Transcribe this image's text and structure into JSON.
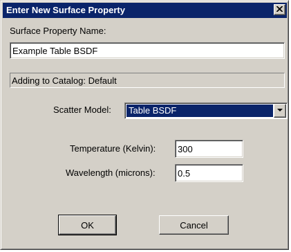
{
  "window": {
    "title": "Enter New Surface Property",
    "close_icon": "close-icon"
  },
  "form": {
    "name_label": "Surface Property Name:",
    "name_value": "Example Table BSDF",
    "catalog_status": "Adding to Catalog: Default",
    "scatter_label": "Scatter Model:",
    "scatter_value": "Table BSDF",
    "temperature_label": "Temperature (Kelvin):",
    "temperature_value": "300",
    "wavelength_label": "Wavelength (microns):",
    "wavelength_value": "0.5"
  },
  "buttons": {
    "ok_label": "OK",
    "cancel_label": "Cancel"
  },
  "colors": {
    "titlebar": "#0a246a",
    "face": "#d4d0c8",
    "selection": "#0a246a"
  }
}
